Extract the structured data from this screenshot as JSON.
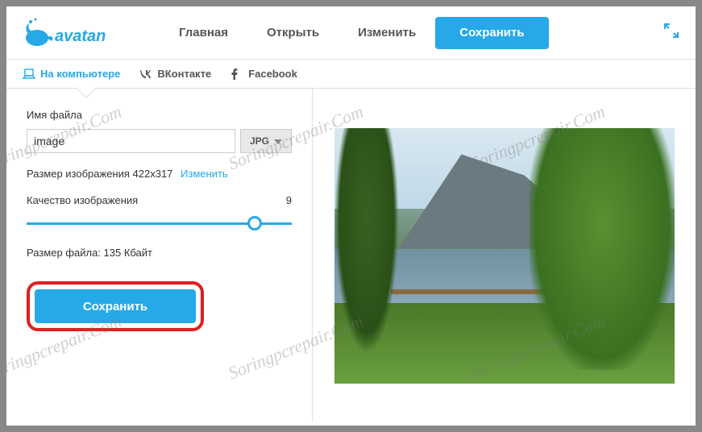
{
  "header": {
    "nav": {
      "home": "Главная",
      "open": "Открыть",
      "edit": "Изменить",
      "save": "Сохранить"
    }
  },
  "tabs": {
    "computer": "На компьютере",
    "vk": "ВКонтакте",
    "facebook": "Facebook"
  },
  "panel": {
    "filename_label": "Имя файла",
    "filename_value": "image",
    "format": "JPG",
    "dimensions_label": "Размер изображения 422x317",
    "change_link": "Изменить",
    "quality_label": "Качество изображения",
    "quality_value": "9",
    "filesize": "Размер файла: 135 Кбайт",
    "save_button": "Сохранить"
  },
  "watermark": "Soringpcrepair.Com"
}
